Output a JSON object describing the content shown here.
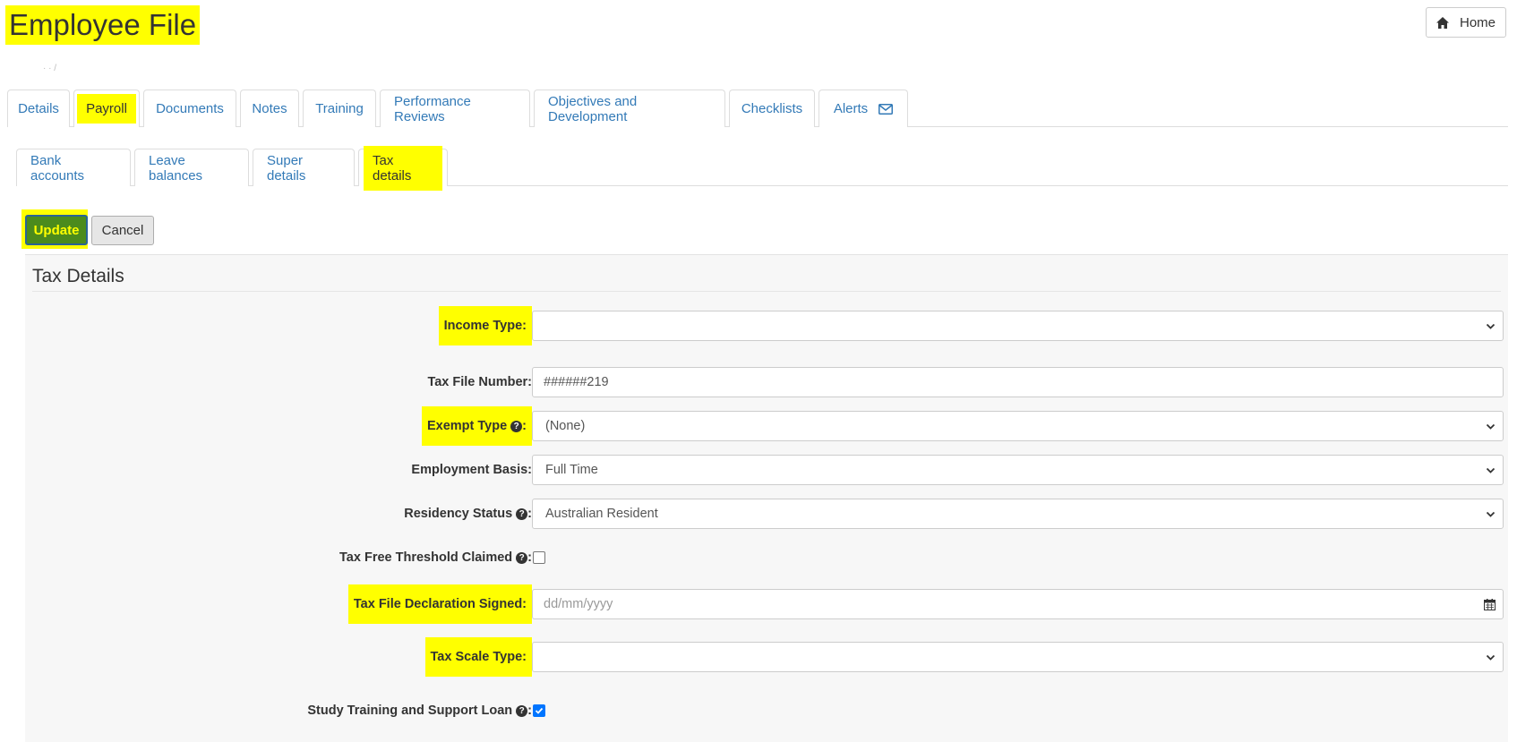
{
  "header": {
    "title": "Employee File",
    "home_label": "Home",
    "stub_text": "· · /"
  },
  "main_tabs": [
    {
      "label": "Details"
    },
    {
      "label": "Payroll"
    },
    {
      "label": "Documents"
    },
    {
      "label": "Notes"
    },
    {
      "label": "Training"
    },
    {
      "label": "Performance Reviews"
    },
    {
      "label": "Objectives and Development"
    },
    {
      "label": "Checklists"
    },
    {
      "label": "Alerts"
    }
  ],
  "sub_tabs": [
    {
      "label": "Bank accounts"
    },
    {
      "label": "Leave balances"
    },
    {
      "label": "Super details"
    },
    {
      "label": "Tax details"
    }
  ],
  "actions": {
    "update_label": "Update",
    "cancel_label": "Cancel"
  },
  "form": {
    "title": "Tax Details",
    "income_type": {
      "label": "Income Type:",
      "value": ""
    },
    "tax_file_number": {
      "label": "Tax File Number:",
      "value": "######219"
    },
    "exempt_type": {
      "label": "Exempt Type",
      "suffix": ":",
      "value": "(None)"
    },
    "employment_basis": {
      "label": "Employment Basis:",
      "value": "Full Time"
    },
    "residency_status": {
      "label": "Residency Status",
      "suffix": ":",
      "value": "Australian Resident"
    },
    "tax_free_threshold": {
      "label": "Tax Free Threshold Claimed",
      "suffix": ":",
      "checked": false
    },
    "tfd_signed": {
      "label": "Tax File Declaration Signed:",
      "placeholder": "dd/mm/yyyy"
    },
    "tax_scale_type": {
      "label": "Tax Scale Type:",
      "value": ""
    },
    "stsl": {
      "label": "Study Training and Support Loan",
      "suffix": ":",
      "checked": true
    }
  },
  "colors": {
    "highlight": "#ffff00",
    "link": "#337ab7",
    "update_bg": "#4b8b1d",
    "checkbox_checked": "#0075ff"
  }
}
